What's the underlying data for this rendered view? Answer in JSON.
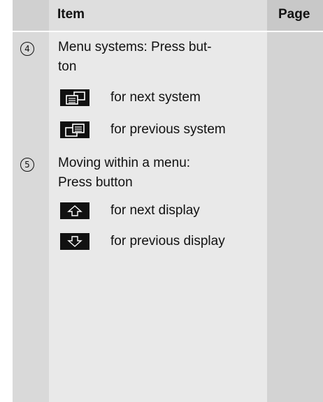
{
  "header": {
    "item_label": "Item",
    "page_label": "Page"
  },
  "rows": [
    {
      "number": "4",
      "text_line1": "Menu systems: Press but-",
      "text_line2": "ton",
      "buttons": [
        {
          "icon": "next-system-icon",
          "label": "for next system"
        },
        {
          "icon": "previous-system-icon",
          "label": "for previous system"
        }
      ]
    },
    {
      "number": "5",
      "text_line1": "Moving within a menu:",
      "text_line2": "Press button",
      "buttons": [
        {
          "icon": "up-arrow-icon",
          "label": "for next display"
        },
        {
          "icon": "down-arrow-icon",
          "label": "for previous display"
        }
      ]
    }
  ]
}
